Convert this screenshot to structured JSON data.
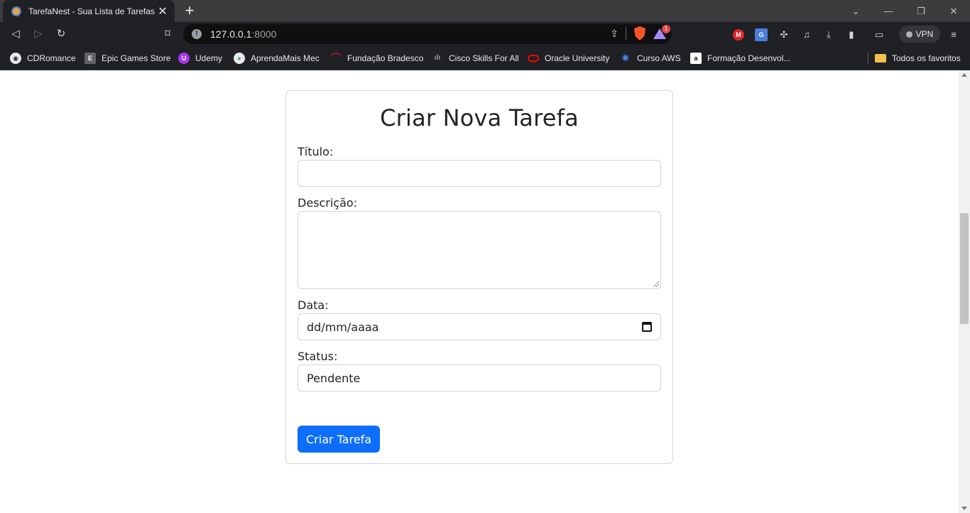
{
  "browser": {
    "tab": {
      "title": "TarefaNest - Sua Lista de Tarefas"
    },
    "url": {
      "host": "127.0.0.1",
      "port": ":8000"
    },
    "rewards_badge": "1",
    "vpn_label": "VPN",
    "icons": {
      "extensions": [
        "mega-icon",
        "translate-icon",
        "puzzle-icon",
        "music-icon",
        "download-icon",
        "sidebar-icon",
        "wallet-icon"
      ]
    },
    "bookmarks": [
      {
        "label": "CDRomance",
        "color": "#e8eaed"
      },
      {
        "label": "Epic Games Store",
        "color": "#9aa0a6"
      },
      {
        "label": "Udemy",
        "color": "#a435f0"
      },
      {
        "label": "AprendaMais Mec",
        "color": "#e8eaed"
      },
      {
        "label": "Fundação Bradesco",
        "color": "#cc092f"
      },
      {
        "label": "Cisco Skills For All",
        "color": "#9aa0a6"
      },
      {
        "label": "Oracle University",
        "color": "#f80000"
      },
      {
        "label": "Curso AWS",
        "color": "#4285f4"
      },
      {
        "label": "Formação Desenvol...",
        "color": "#ffffff"
      }
    ],
    "all_bookmarks_label": "Todos os favoritos"
  },
  "form": {
    "title": "Criar Nova Tarefa",
    "fields": {
      "titulo_label": "Título:",
      "titulo_value": "",
      "descricao_label": "Descrição:",
      "descricao_value": "",
      "data_label": "Data:",
      "data_placeholder": "dd/mm/aaaa",
      "status_label": "Status:",
      "status_value": "Pendente"
    },
    "submit_label": "Criar Tarefa"
  },
  "colors": {
    "primary": "#0d6efd",
    "browser_chrome": "#202124"
  }
}
